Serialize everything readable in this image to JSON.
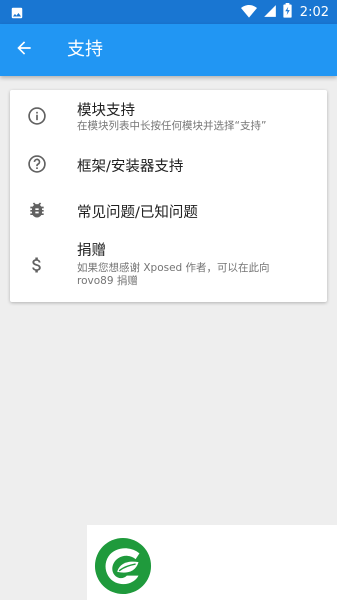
{
  "status_bar": {
    "time": "2:02",
    "icons": [
      "image-icon",
      "wifi-icon",
      "signal-icon",
      "battery-charging-icon"
    ]
  },
  "app_bar": {
    "title": "支持",
    "back_icon": "arrow-back-icon"
  },
  "support_items": [
    {
      "icon": "info-icon",
      "title": "模块支持",
      "subtitle": "在模块列表中长按任何模块并选择“支持”"
    },
    {
      "icon": "help-circle-icon",
      "title": "框架/安装器支持"
    },
    {
      "icon": "bug-icon",
      "title": "常见问题/已知问题"
    },
    {
      "icon": "dollar-icon",
      "title": "捐赠",
      "subtitle": "如果您想感谢 Xposed 作者，可以在此向 rovo89 捐赠"
    }
  ],
  "colors": {
    "status_bar": "#1976d2",
    "app_bar": "#2196f3",
    "background": "#eeeeee",
    "card": "#ffffff",
    "logo_green": "#1f9a3c"
  },
  "bottom_logo": "leaf-logo-icon"
}
